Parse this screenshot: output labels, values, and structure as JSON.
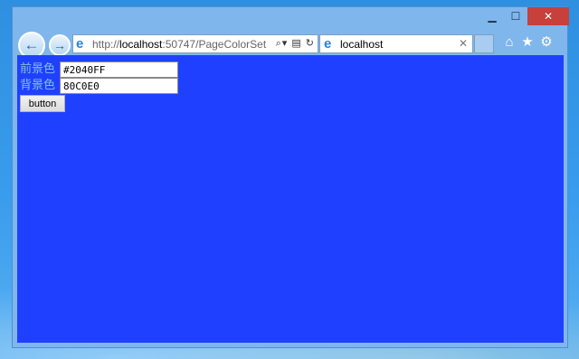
{
  "titlebar": {
    "minimize_glyph": "▁",
    "maximize_glyph": "☐",
    "close_glyph": "✕"
  },
  "nav": {
    "back_glyph": "←",
    "forward_glyph": "→"
  },
  "address": {
    "prefix": "http://",
    "host": "localhost",
    "rest": ":50747/PageColorSet",
    "tools": "⌕▾ ▤ ↻"
  },
  "tab": {
    "title": "localhost",
    "close_glyph": "✕"
  },
  "toolbar": {
    "home_glyph": "⌂",
    "favorites_glyph": "★",
    "tools_glyph": "⚙"
  },
  "form": {
    "foreground_label": "前景色",
    "foreground_value": "#2040FF",
    "background_label": "背景色",
    "background_value": "80C0E0",
    "button_label": "button"
  },
  "colors": {
    "page_background": "#2040FF",
    "label_text": "#80C0E0",
    "window_frame": "#7fb6ec",
    "close_button": "#c7403b"
  },
  "icons": [
    "back-icon",
    "forward-icon",
    "ie-logo-icon",
    "home-icon",
    "star-icon",
    "gear-icon",
    "close-icon"
  ]
}
